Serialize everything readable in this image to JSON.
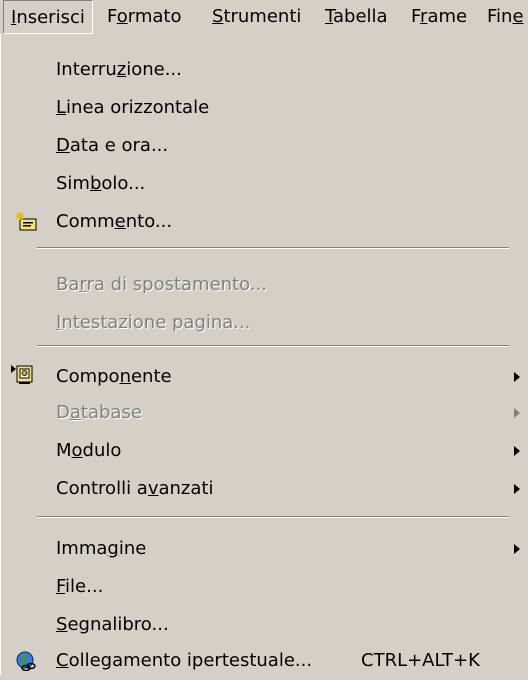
{
  "menubar": {
    "items": [
      {
        "pre": "",
        "u": "I",
        "post": "nserisci"
      },
      {
        "pre": "F",
        "u": "o",
        "post": "rmato"
      },
      {
        "pre": "",
        "u": "S",
        "post": "trumenti"
      },
      {
        "pre": "",
        "u": "T",
        "post": "abella"
      },
      {
        "pre": "F",
        "u": "r",
        "post": "ame"
      },
      {
        "pre": "Fin",
        "u": "e",
        "post": ""
      }
    ]
  },
  "menu": {
    "items": [
      {
        "pre": "Interru",
        "u": "z",
        "post": "ione..."
      },
      {
        "pre": "",
        "u": "L",
        "post": "inea orizzontale"
      },
      {
        "pre": "",
        "u": "D",
        "post": "ata e ora..."
      },
      {
        "pre": "Sim",
        "u": "b",
        "post": "olo..."
      },
      {
        "pre": "Comm",
        "u": "e",
        "post": "nto...",
        "icon": "new-comment-icon"
      },
      {
        "pre": "Ba",
        "u": "r",
        "post": "ra di spostamento...",
        "disabled": true
      },
      {
        "pre": "",
        "u": "I",
        "post": "ntestazione pagina...",
        "disabled": true
      },
      {
        "pre": "Compo",
        "u": "n",
        "post": "ente",
        "icon": "component-icon",
        "submenu": true
      },
      {
        "pre": "D",
        "u": "a",
        "post": "tabase",
        "disabled": true,
        "submenu": true
      },
      {
        "pre": "M",
        "u": "o",
        "post": "dulo",
        "submenu": true
      },
      {
        "pre": "Controlli a",
        "u": "v",
        "post": "anzati",
        "submenu": true
      },
      {
        "pre": "Imma",
        "u": "g",
        "post": "ine",
        "submenu": true
      },
      {
        "pre": "",
        "u": "F",
        "post": "ile..."
      },
      {
        "pre": "",
        "u": "S",
        "post": "egnalibro..."
      },
      {
        "pre": "",
        "u": "C",
        "post": "ollegamento ipertestuale...",
        "icon": "hyperlink-globe-icon",
        "shortcut": "CTRL+ALT+K"
      }
    ]
  },
  "colors": {
    "menu_bg": "#d4d0c8",
    "disabled_text": "#808080",
    "separator_dark": "#808080",
    "separator_light": "#ffffff"
  }
}
